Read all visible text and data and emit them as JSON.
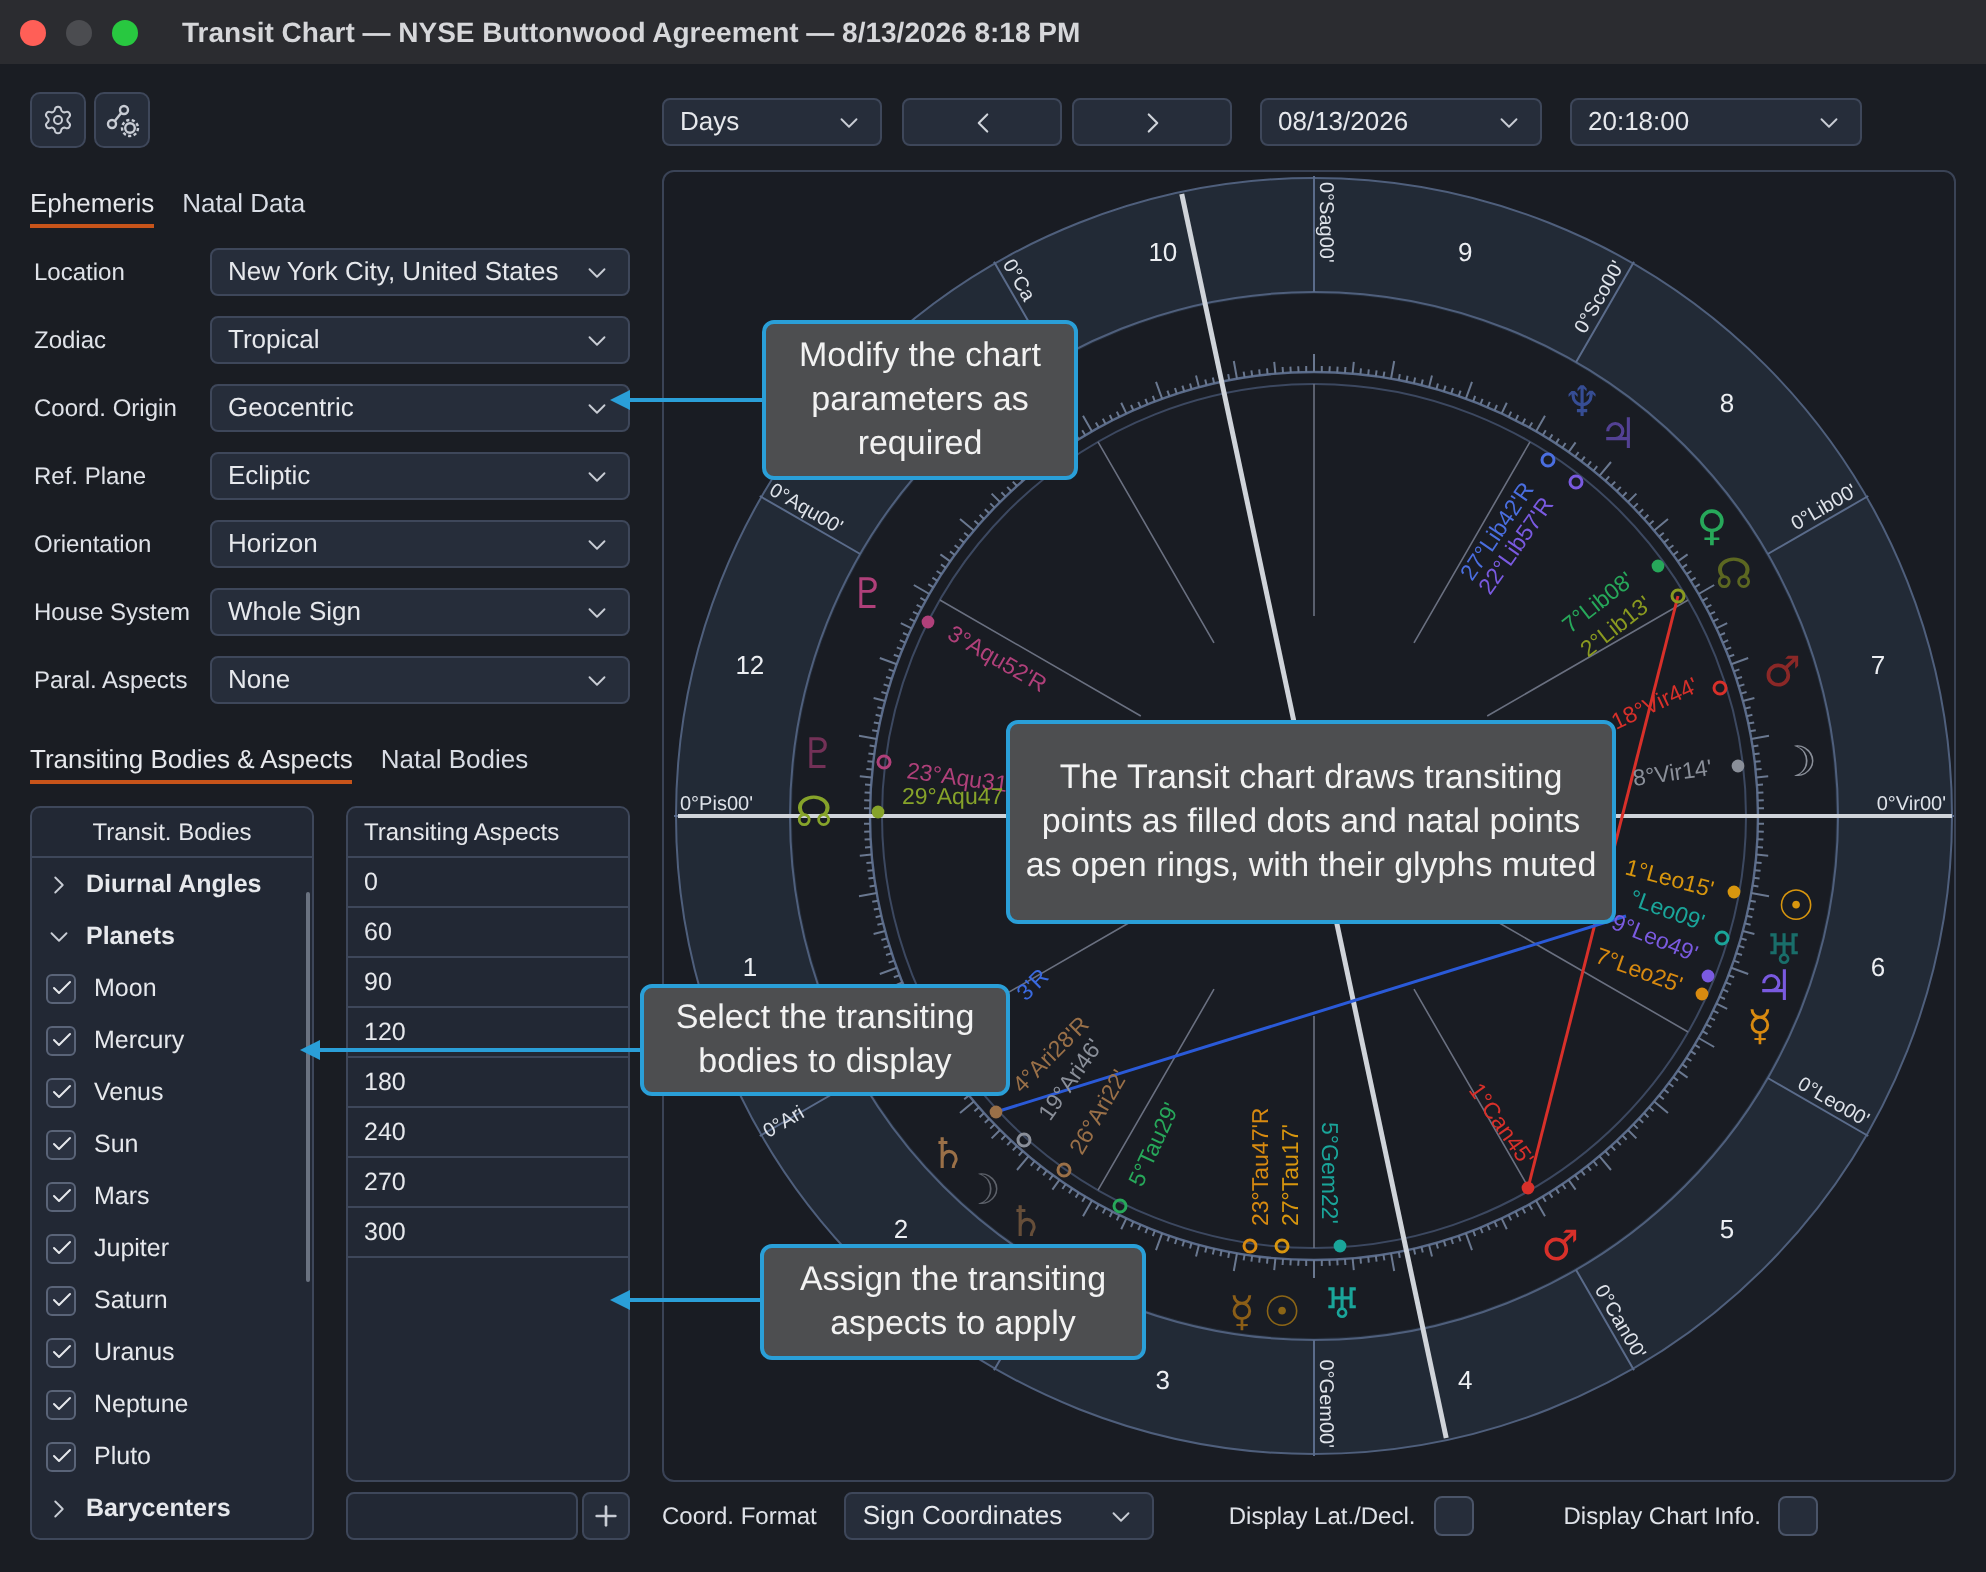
{
  "window": {
    "title": "Transit Chart — NYSE Buttonwood Agreement — 8/13/2026 8:18 PM"
  },
  "settings_tabs": [
    {
      "label": "Ephemeris",
      "selected": true
    },
    {
      "label": "Natal Data",
      "selected": false
    }
  ],
  "settings": [
    {
      "label": "Location",
      "value": "New York City, United States"
    },
    {
      "label": "Zodiac",
      "value": "Tropical"
    },
    {
      "label": "Coord. Origin",
      "value": "Geocentric"
    },
    {
      "label": "Ref. Plane",
      "value": "Ecliptic"
    },
    {
      "label": "Orientation",
      "value": "Horizon"
    },
    {
      "label": "House System",
      "value": "Whole Sign"
    },
    {
      "label": "Paral. Aspects",
      "value": "None"
    }
  ],
  "body_tabs": [
    {
      "label": "Transiting Bodies & Aspects",
      "selected": true
    },
    {
      "label": "Natal Bodies",
      "selected": false
    }
  ],
  "transit_bodies": {
    "header": "Transit. Bodies",
    "groups": [
      {
        "label": "Diurnal Angles",
        "expanded": false
      },
      {
        "label": "Planets",
        "expanded": true,
        "children": [
          {
            "label": "Moon",
            "checked": true
          },
          {
            "label": "Mercury",
            "checked": true
          },
          {
            "label": "Venus",
            "checked": true
          },
          {
            "label": "Sun",
            "checked": true
          },
          {
            "label": "Mars",
            "checked": true
          },
          {
            "label": "Jupiter",
            "checked": true
          },
          {
            "label": "Saturn",
            "checked": true
          },
          {
            "label": "Uranus",
            "checked": true
          },
          {
            "label": "Neptune",
            "checked": true
          },
          {
            "label": "Pluto",
            "checked": true
          }
        ]
      },
      {
        "label": "Barycenters",
        "expanded": false
      }
    ]
  },
  "aspects": {
    "header": "Transiting Aspects",
    "rows": [
      "0",
      "60",
      "90",
      "120",
      "180",
      "240",
      "270",
      "300"
    ]
  },
  "chart_toolbar": {
    "period": "Days",
    "date": "08/13/2026",
    "time": "20:18:00"
  },
  "chart": {
    "house_numbers": [
      "10",
      "9",
      "8",
      "12",
      "7",
      "1",
      "6",
      "2",
      "5",
      "3",
      "4"
    ],
    "sign_cusps": [
      "0°Sag00'",
      "0°Ca",
      "0°Sco00'",
      "0°Aqu00'",
      "0°Lib00'",
      "0°Pis00'",
      "0°Vir00'",
      "0°Leo00'",
      "0°Ari",
      "0°Can00'",
      "0°Gem00'"
    ],
    "points": [
      {
        "label": "3°Aqu52'R",
        "glyph": "♇",
        "color": "#b0407a",
        "transiting": true
      },
      {
        "label": "23°Aqu31",
        "glyph": "♇",
        "color": "#b0407a",
        "transiting": false
      },
      {
        "label": "29°Aqu47",
        "glyph": "☊",
        "color": "#86a32a",
        "transiting": true
      },
      {
        "label": "27°Lib42'R",
        "glyph": "♆",
        "color": "#4a6ee0",
        "transiting": false
      },
      {
        "label": "22°Lib57'R",
        "glyph": "♃",
        "color": "#7a5ae0",
        "transiting": false
      },
      {
        "label": "7°Lib08'",
        "glyph": "♀",
        "color": "#27a85a",
        "transiting": true
      },
      {
        "label": "2°Lib13'",
        "glyph": "☊",
        "color": "#8a9a20",
        "transiting": false
      },
      {
        "label": "18°Vir44'",
        "glyph": "♂",
        "color": "#d8302a",
        "transiting": false
      },
      {
        "label": "8°Vir14'",
        "glyph": "☽",
        "color": "#8a8f99",
        "transiting": true
      },
      {
        "label": "1°Leo15'",
        "glyph": "☉",
        "color": "#d8960e",
        "transiting": true
      },
      {
        "label": "°Leo09'",
        "glyph": "♅",
        "color": "#1aa59a",
        "transiting": false
      },
      {
        "label": "9°Leo49'",
        "glyph": "♃",
        "color": "#7a5ae0",
        "transiting": true
      },
      {
        "label": "7°Leo25'",
        "glyph": "☿",
        "color": "#d88a10",
        "transiting": true
      },
      {
        "label": "3'R",
        "color": "#3a6ae0"
      },
      {
        "label": "4°Ari28'R",
        "glyph": "♄",
        "color": "#9a7048",
        "transiting": true
      },
      {
        "label": "19°Ari46'",
        "glyph": "☽",
        "color": "#8a8f99",
        "transiting": false
      },
      {
        "label": "26°Ari22'",
        "glyph": "♄",
        "color": "#9a7048",
        "transiting": false
      },
      {
        "label": "5°Tau29'",
        "color": "#27a85a",
        "transiting": false
      },
      {
        "label": "23°Tau47'R",
        "glyph": "☿",
        "color": "#d88a10",
        "transiting": false
      },
      {
        "label": "27°Tau17'",
        "glyph": "☉",
        "color": "#d8960e",
        "transiting": false
      },
      {
        "label": "5°Gem22'",
        "glyph": "♅",
        "color": "#1aa59a",
        "transiting": true
      },
      {
        "label": "1°Can45'",
        "glyph": "♂",
        "color": "#d8302a",
        "transiting": true
      }
    ]
  },
  "bottom_bar": {
    "coord_format_label": "Coord. Format",
    "coord_format": "Sign Coordinates",
    "options": [
      {
        "label": "Display Lat./Decl.",
        "checked": false
      },
      {
        "label": "Display Chart Info.",
        "checked": false
      }
    ]
  },
  "callouts": [
    "Modify the chart parameters as required",
    "The Transit chart draws transiting points as filled dots and natal points as open rings, with their glyphs muted",
    "Select the transiting bodies to display",
    "Assign the transiting aspects to apply"
  ]
}
